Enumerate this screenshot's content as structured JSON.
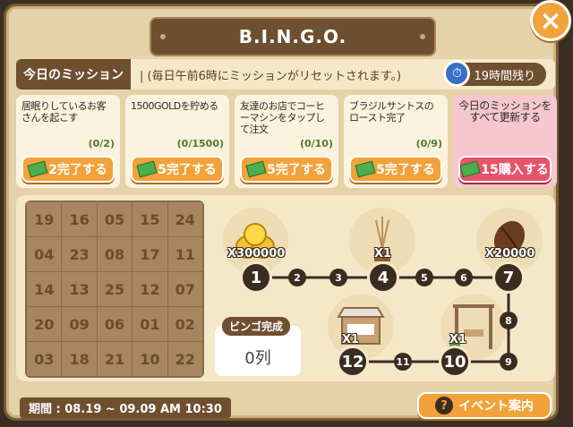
{
  "header": {
    "title": "B.I.N.G.O."
  },
  "close_label": "×",
  "mission": {
    "label": "今日のミッション",
    "note": "| (毎日午前6時にミッションがリセットされます。)",
    "timer": "19時間残り"
  },
  "cards": [
    {
      "text": "居眠りしているお客さんを起こす",
      "progress": "(0/2)",
      "button": "2完了する",
      "kind": "complete"
    },
    {
      "text": "1500GOLDを貯める",
      "progress": "(0/1500)",
      "button": "5完了する",
      "kind": "complete"
    },
    {
      "text": "友達のお店でコーヒーマシンをタップして注文",
      "progress": "(0/10)",
      "button": "5完了する",
      "kind": "complete"
    },
    {
      "text": "ブラジルサントスのロースト完了",
      "progress": "(0/9)",
      "button": "5完了する",
      "kind": "complete"
    },
    {
      "text": "今日のミッションをすべて更新する",
      "progress": "",
      "button": "15購入する",
      "kind": "purchase"
    }
  ],
  "bingo_grid": [
    [
      "19",
      "16",
      "05",
      "15",
      "24"
    ],
    [
      "04",
      "23",
      "08",
      "17",
      "11"
    ],
    [
      "14",
      "13",
      "25",
      "12",
      "07"
    ],
    [
      "20",
      "09",
      "06",
      "01",
      "02"
    ],
    [
      "03",
      "18",
      "21",
      "10",
      "22"
    ]
  ],
  "bingo_status": {
    "label": "ビンゴ完成",
    "value": "0列"
  },
  "path": {
    "major_nodes": [
      "1",
      "4",
      "7",
      "10",
      "12"
    ],
    "minor_nodes": [
      "2",
      "3",
      "5",
      "6",
      "8",
      "9",
      "11"
    ],
    "rewards": [
      {
        "node": "1",
        "label": "X300000",
        "icon": "gold-coins-icon"
      },
      {
        "node": "4",
        "label": "X1",
        "icon": "plant-decor-icon"
      },
      {
        "node": "7",
        "label": "X20000",
        "icon": "coffee-bean-icon"
      },
      {
        "node": "10",
        "label": "X1",
        "icon": "swing-decor-icon"
      },
      {
        "node": "12",
        "label": "X1",
        "icon": "cafe-booth-icon"
      }
    ]
  },
  "footer": {
    "period": "期間 : 08.19 ~ 09.09 AM 10:30",
    "guide_button": "イベント案内"
  }
}
